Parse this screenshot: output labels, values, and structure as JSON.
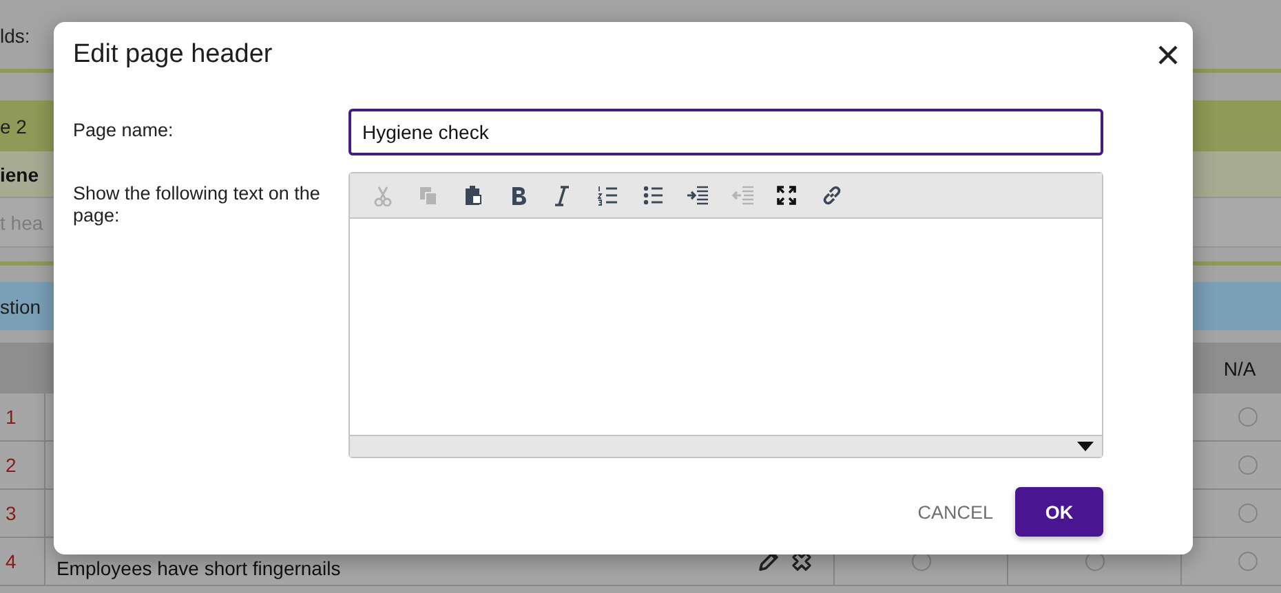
{
  "background": {
    "fields_label": "lds:",
    "bands": [
      {
        "kind": "section",
        "text": "e 2"
      },
      {
        "kind": "title",
        "text": "iene"
      },
      {
        "kind": "placeholder",
        "text": "t hea"
      },
      {
        "kind": "group",
        "text": "stion"
      }
    ],
    "table": {
      "columns": [
        {
          "label": "N/A"
        }
      ],
      "rows": [
        {
          "number": "1",
          "options": [
            {
              "selected": false
            }
          ]
        },
        {
          "number": "2",
          "options": [
            {
              "selected": false
            }
          ]
        },
        {
          "number": "3",
          "options": [
            {
              "selected": false
            }
          ]
        },
        {
          "number": "4",
          "question": "Employees have short fingernails",
          "options": [
            {
              "selected": false
            },
            {
              "selected": false
            },
            {
              "selected": false
            }
          ]
        }
      ]
    }
  },
  "dialog": {
    "title": "Edit page header",
    "page_name": {
      "label": "Page name:",
      "value": "Hygiene check"
    },
    "editor": {
      "label": "Show the following text on the page:",
      "toolbar": [
        {
          "kind": "cut",
          "disabled": true
        },
        {
          "kind": "copy",
          "disabled": true
        },
        {
          "kind": "paste",
          "disabled": false
        },
        {
          "kind": "bold",
          "disabled": false
        },
        {
          "kind": "italic",
          "disabled": false
        },
        {
          "kind": "numbered-list",
          "disabled": false
        },
        {
          "kind": "bulleted-list",
          "disabled": false
        },
        {
          "kind": "indent",
          "disabled": false
        },
        {
          "kind": "outdent",
          "disabled": true
        },
        {
          "kind": "maximize",
          "disabled": false
        },
        {
          "kind": "link",
          "disabled": false
        }
      ]
    },
    "buttons": [
      {
        "kind": "text",
        "label": "CANCEL"
      },
      {
        "kind": "primary",
        "label": "OK"
      }
    ]
  }
}
